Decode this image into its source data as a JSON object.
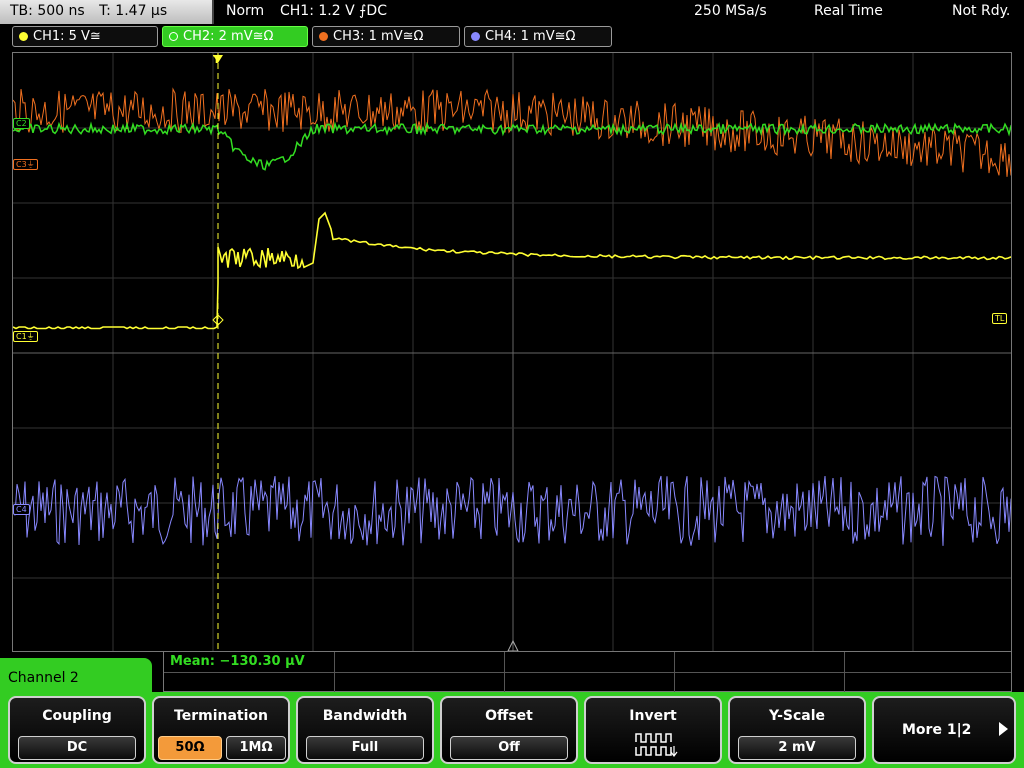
{
  "status_bar": {
    "timebase": "TB: 500 ns",
    "trigger_time": "T: 1.47 µs",
    "mode": "Norm",
    "trigger_info": "CH1: 1.2 V ⨍DC",
    "sample_rate": "250 MSa/s",
    "acquisition": "Real Time",
    "ready_state": "Not Rdy."
  },
  "channels": [
    {
      "label": "CH1: 5 V≅",
      "color": "#ffff33"
    },
    {
      "label": "CH2: 2 mV≅Ω",
      "color": "#33dd22"
    },
    {
      "label": "CH3: 1 mV≅Ω",
      "color": "#f07020"
    },
    {
      "label": "CH4: 1 mV≅Ω",
      "color": "#8888ff"
    }
  ],
  "markers": {
    "c3": "C3⏚",
    "c2": "C2",
    "c1": "C1⏚",
    "c4": "C4",
    "trigger_level": "TL",
    "trigger_point": "T"
  },
  "measurement": {
    "mean": "Mean: −130.30 µV"
  },
  "active_channel": "Channel 2",
  "softkeys": {
    "coupling": {
      "title": "Coupling",
      "value": "DC"
    },
    "termination": {
      "title": "Termination",
      "options": [
        "50Ω",
        "1MΩ"
      ],
      "selected": "50Ω"
    },
    "bandwidth": {
      "title": "Bandwidth",
      "value": "Full"
    },
    "offset": {
      "title": "Offset",
      "value": "Off"
    },
    "invert": {
      "title": "Invert",
      "icon": "invert-waveform-icon"
    },
    "yscale": {
      "title": "Y-Scale",
      "value": "2 mV"
    },
    "more": {
      "label": "More 1|2",
      "icon": "arrow-right-icon"
    }
  },
  "colors": {
    "ch1": "#ffff33",
    "ch2": "#33dd22",
    "ch3": "#f07020",
    "ch4": "#8888ff",
    "accent": "#33cc22",
    "selected": "#f39a3a"
  }
}
